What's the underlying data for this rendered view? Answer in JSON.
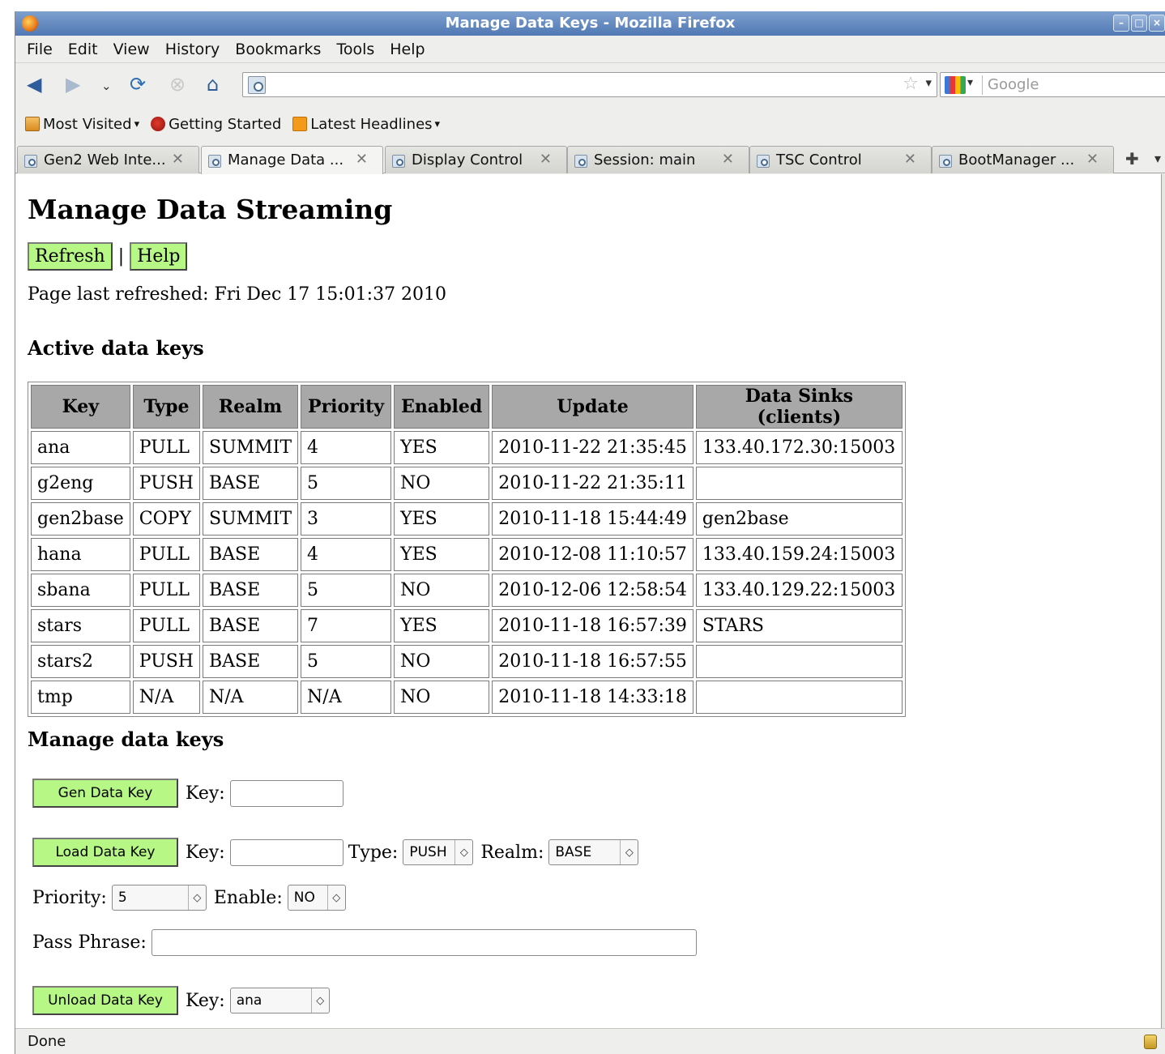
{
  "window": {
    "title": "Manage Data Keys - Mozilla Firefox"
  },
  "menu": [
    "File",
    "Edit",
    "View",
    "History",
    "Bookmarks",
    "Tools",
    "Help"
  ],
  "search": {
    "placeholder": "Google"
  },
  "bookmarks": [
    {
      "label": "Most Visited",
      "icon": "folder-icon",
      "dropdown": true
    },
    {
      "label": "Getting Started",
      "icon": "getting-started-icon",
      "dropdown": false
    },
    {
      "label": "Latest Headlines",
      "icon": "rss-icon",
      "dropdown": true
    }
  ],
  "tabs": [
    {
      "label": "Gen2 Web Inte...",
      "active": false
    },
    {
      "label": "Manage Data ...",
      "active": true
    },
    {
      "label": "Display Control",
      "active": false
    },
    {
      "label": "Session: main",
      "active": false
    },
    {
      "label": "TSC Control",
      "active": false
    },
    {
      "label": "BootManager ...",
      "active": false
    }
  ],
  "page": {
    "title": "Manage Data Streaming",
    "refresh_label": "Refresh",
    "pipe": "|",
    "help_label": "Help",
    "last_refreshed": "Page last refreshed: Fri Dec 17 15:01:37 2010",
    "active_heading": "Active data keys",
    "manage_heading": "Manage data keys"
  },
  "table": {
    "columns": [
      "Key",
      "Type",
      "Realm",
      "Priority",
      "Enabled",
      "Update",
      "Data Sinks (clients)"
    ],
    "rows": [
      [
        "ana",
        "PULL",
        "SUMMIT",
        "4",
        "YES",
        "2010-11-22 21:35:45",
        "133.40.172.30:15003"
      ],
      [
        "g2eng",
        "PUSH",
        "BASE",
        "5",
        "NO",
        "2010-11-22 21:35:11",
        ""
      ],
      [
        "gen2base",
        "COPY",
        "SUMMIT",
        "3",
        "YES",
        "2010-11-18 15:44:49",
        "gen2base"
      ],
      [
        "hana",
        "PULL",
        "BASE",
        "4",
        "YES",
        "2010-12-08 11:10:57",
        "133.40.159.24:15003"
      ],
      [
        "sbana",
        "PULL",
        "BASE",
        "5",
        "NO",
        "2010-12-06 12:58:54",
        "133.40.129.22:15003"
      ],
      [
        "stars",
        "PULL",
        "BASE",
        "7",
        "YES",
        "2010-11-18 16:57:39",
        "STARS"
      ],
      [
        "stars2",
        "PUSH",
        "BASE",
        "5",
        "NO",
        "2010-11-18 16:57:55",
        ""
      ],
      [
        "tmp",
        "N/A",
        "N/A",
        "N/A",
        "NO",
        "2010-11-18 14:33:18",
        ""
      ]
    ]
  },
  "forms": {
    "gen": {
      "button": "Gen Data Key",
      "key_label": "Key:",
      "key_value": ""
    },
    "load": {
      "button": "Load Data Key",
      "key_label": "Key:",
      "key_value": "",
      "type_label": "Type:",
      "type_value": "PUSH",
      "realm_label": "Realm:",
      "realm_value": "BASE",
      "priority_label": "Priority:",
      "priority_value": "5",
      "enable_label": "Enable:",
      "enable_value": "NO",
      "pass_label": "Pass Phrase:",
      "pass_value": ""
    },
    "unload": {
      "button": "Unload Data Key",
      "key_label": "Key:",
      "key_value": "ana"
    }
  },
  "status": {
    "text": "Done"
  }
}
